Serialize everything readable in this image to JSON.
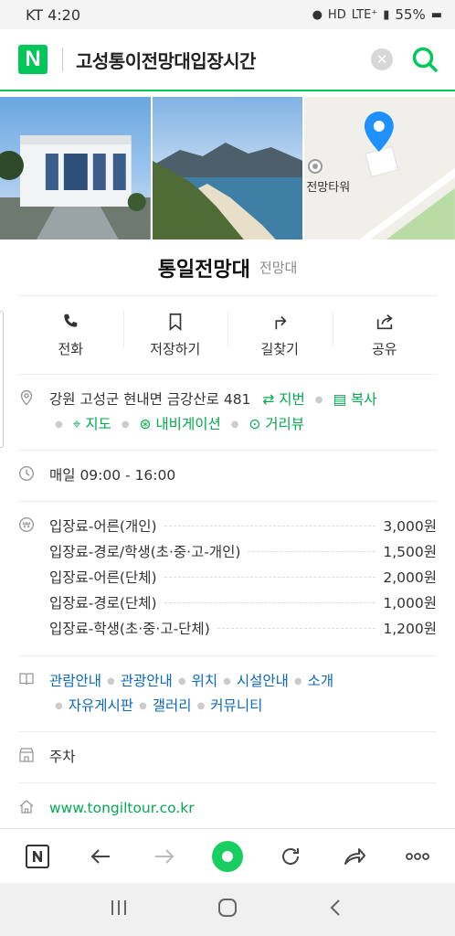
{
  "status_bar": {
    "carrier_time": "KT 4:20",
    "network": "LTE⁺",
    "battery": "55%"
  },
  "search": {
    "logo": "N",
    "query": "고성통이전망대입장시간"
  },
  "map": {
    "label": "전망타워"
  },
  "place": {
    "name": "통일전망대",
    "category": "전망대"
  },
  "actions": [
    {
      "label": "전화",
      "icon": "phone-icon"
    },
    {
      "label": "저장하기",
      "icon": "bookmark-icon"
    },
    {
      "label": "길찾기",
      "icon": "directions-icon"
    },
    {
      "label": "공유",
      "icon": "share-icon"
    }
  ],
  "address": {
    "text": "강원 고성군 현내면 금강산로 481",
    "links": [
      "지번",
      "복사",
      "지도",
      "내비게이션",
      "거리뷰"
    ]
  },
  "hours": {
    "text": "매일 09:00 - 16:00"
  },
  "fees": [
    {
      "name": "입장료-어른(개인)",
      "price": "3,000원"
    },
    {
      "name": "입장료-경로/학생(초·중·고-개인)",
      "price": "1,500원"
    },
    {
      "name": "입장료-어른(단체)",
      "price": "2,000원"
    },
    {
      "name": "입장료-경로(단체)",
      "price": "1,000원"
    },
    {
      "name": "입장료-학생(초·중·고-단체)",
      "price": "1,200원"
    }
  ],
  "info_links": [
    "관람안내",
    "관광안내",
    "위치",
    "시설안내",
    "소개",
    "자유게시판",
    "갤러리",
    "커뮤니티"
  ],
  "parking": {
    "text": "주차"
  },
  "website": {
    "text": "www.tongiltour.co.kr"
  },
  "colors": {
    "brand_green": "#03c75a",
    "link_blue": "#0b68ba"
  }
}
